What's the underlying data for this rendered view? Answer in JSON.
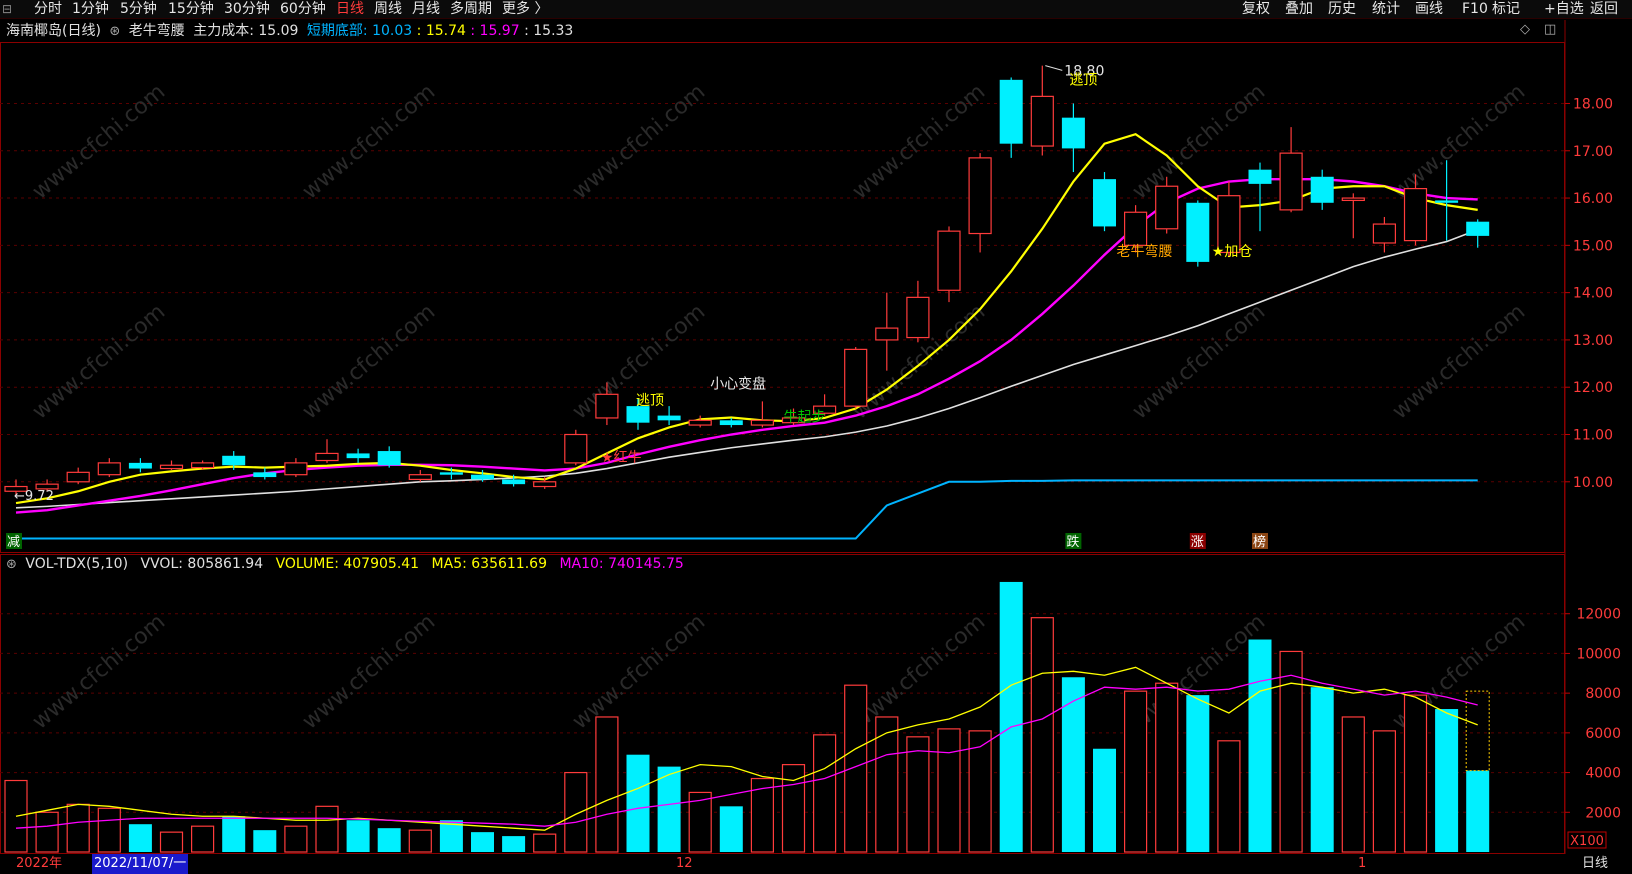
{
  "toolbar": {
    "periods": [
      "分时",
      "1分钟",
      "5分钟",
      "15分钟",
      "30分钟",
      "60分钟",
      "日线",
      "周线",
      "月线",
      "多周期",
      "更多 〉"
    ],
    "active_period": "日线",
    "right_buttons": [
      "复权",
      "叠加",
      "历史",
      "统计",
      "画线",
      "F10",
      "标记",
      "+自选",
      "返回"
    ]
  },
  "info": {
    "stock": "海南椰岛(日线)",
    "indicator": "老牛弯腰",
    "cost_label": "主力成本:",
    "cost_value": "15.09",
    "bottom_label": "短期底部:",
    "bottom_value": "10.03",
    "v1": "15.74",
    "v2": "15.97",
    "v3": "15.33"
  },
  "vol": {
    "name": "VOL-TDX(5,10)",
    "vvol": "VVOL: 805861.94",
    "volume": "VOLUME: 407905.41",
    "ma5": "MA5: 635611.69",
    "ma10": "MA10: 740145.75"
  },
  "price_axis": [
    "18.00",
    "17.00",
    "16.00",
    "15.00",
    "14.00",
    "13.00",
    "12.00",
    "11.00",
    "10.00"
  ],
  "vol_axis": [
    "12000",
    "10000",
    "8000",
    "6000",
    "4000",
    "2000"
  ],
  "vol_unit": "X100",
  "annotations": {
    "high": "18.80",
    "low": "9.72",
    "escape1": "逃顶",
    "escape2": "逃顶",
    "careful": "小心变盘",
    "bull_start": "牛起步",
    "red_bull": "★红牛",
    "old_bull": "老牛弯腰",
    "add_pos": "★加仓",
    "m_jian": "减",
    "m_die": "跌",
    "m_zhang": "涨",
    "m_bang": "榜"
  },
  "dates": {
    "year": "2022年",
    "sel": "2022/11/07/一",
    "m12": "12",
    "m1": "1"
  },
  "footer_period": "日线",
  "watermark": "www.cfchi.com",
  "colors": {
    "up": "#ff3b3b",
    "down": "#00f0ff",
    "ma_yellow": "#ffff00",
    "ma_magenta": "#ff00ff",
    "ma_white": "#e0e0e0",
    "bottom_line": "#00b4ff"
  },
  "chart_data": {
    "type": "candlestick",
    "candles": [
      {
        "o": 9.8,
        "c": 9.9,
        "h": 10.05,
        "l": 9.72,
        "v": 3600
      },
      {
        "o": 9.85,
        "c": 9.95,
        "h": 10.05,
        "l": 9.8,
        "v": 2000
      },
      {
        "o": 10.0,
        "c": 10.2,
        "h": 10.3,
        "l": 9.95,
        "v": 2400
      },
      {
        "o": 10.15,
        "c": 10.4,
        "h": 10.5,
        "l": 10.1,
        "v": 2200
      },
      {
        "o": 10.4,
        "c": 10.28,
        "h": 10.5,
        "l": 10.2,
        "v": 1400
      },
      {
        "o": 10.28,
        "c": 10.35,
        "h": 10.45,
        "l": 10.25,
        "v": 1000
      },
      {
        "o": 10.3,
        "c": 10.4,
        "h": 10.45,
        "l": 10.25,
        "v": 1300
      },
      {
        "o": 10.55,
        "c": 10.35,
        "h": 10.65,
        "l": 10.25,
        "v": 1800
      },
      {
        "o": 10.2,
        "c": 10.1,
        "h": 10.3,
        "l": 10.05,
        "v": 1100
      },
      {
        "o": 10.15,
        "c": 10.4,
        "h": 10.5,
        "l": 10.1,
        "v": 1300
      },
      {
        "o": 10.45,
        "c": 10.6,
        "h": 10.9,
        "l": 10.4,
        "v": 2300
      },
      {
        "o": 10.6,
        "c": 10.5,
        "h": 10.7,
        "l": 10.4,
        "v": 1600
      },
      {
        "o": 10.65,
        "c": 10.35,
        "h": 10.75,
        "l": 10.3,
        "v": 1200
      },
      {
        "o": 10.05,
        "c": 10.15,
        "h": 10.25,
        "l": 10.0,
        "v": 1100
      },
      {
        "o": 10.2,
        "c": 10.15,
        "h": 10.3,
        "l": 10.05,
        "v": 1600
      },
      {
        "o": 10.15,
        "c": 10.05,
        "h": 10.25,
        "l": 10.0,
        "v": 1000
      },
      {
        "o": 10.05,
        "c": 9.95,
        "h": 10.15,
        "l": 9.9,
        "v": 800
      },
      {
        "o": 9.9,
        "c": 10.0,
        "h": 10.1,
        "l": 9.85,
        "v": 900
      },
      {
        "o": 10.4,
        "c": 11.0,
        "h": 11.1,
        "l": 10.35,
        "v": 4000
      },
      {
        "o": 11.35,
        "c": 11.85,
        "h": 12.1,
        "l": 11.2,
        "v": 6800
      },
      {
        "o": 11.6,
        "c": 11.25,
        "h": 11.75,
        "l": 11.1,
        "v": 4900
      },
      {
        "o": 11.4,
        "c": 11.3,
        "h": 11.6,
        "l": 11.2,
        "v": 4300
      },
      {
        "o": 11.2,
        "c": 11.3,
        "h": 11.4,
        "l": 11.15,
        "v": 3000
      },
      {
        "o": 11.3,
        "c": 11.2,
        "h": 11.35,
        "l": 11.15,
        "v": 2300
      },
      {
        "o": 11.2,
        "c": 11.3,
        "h": 11.7,
        "l": 11.15,
        "v": 3700
      },
      {
        "o": 11.25,
        "c": 11.35,
        "h": 11.55,
        "l": 11.2,
        "v": 4400
      },
      {
        "o": 11.45,
        "c": 11.6,
        "h": 11.85,
        "l": 11.4,
        "v": 5900
      },
      {
        "o": 11.6,
        "c": 12.8,
        "h": 12.85,
        "l": 11.55,
        "v": 8400
      },
      {
        "o": 13.0,
        "c": 13.25,
        "h": 14.0,
        "l": 12.35,
        "v": 6800
      },
      {
        "o": 13.05,
        "c": 13.9,
        "h": 14.25,
        "l": 12.95,
        "v": 5800
      },
      {
        "o": 14.05,
        "c": 15.3,
        "h": 15.4,
        "l": 13.8,
        "v": 6200
      },
      {
        "o": 15.25,
        "c": 16.85,
        "h": 16.95,
        "l": 14.85,
        "v": 6100
      },
      {
        "o": 18.5,
        "c": 17.15,
        "h": 18.55,
        "l": 16.85,
        "v": 13600
      },
      {
        "o": 17.1,
        "c": 18.15,
        "h": 18.8,
        "l": 16.9,
        "v": 11800
      },
      {
        "o": 17.7,
        "c": 17.05,
        "h": 18.0,
        "l": 16.55,
        "v": 8800
      },
      {
        "o": 16.4,
        "c": 15.4,
        "h": 16.55,
        "l": 15.3,
        "v": 5200
      },
      {
        "o": 15.0,
        "c": 15.7,
        "h": 15.85,
        "l": 14.85,
        "v": 8100
      },
      {
        "o": 15.35,
        "c": 16.25,
        "h": 16.45,
        "l": 15.25,
        "v": 8500
      },
      {
        "o": 15.9,
        "c": 14.65,
        "h": 15.95,
        "l": 14.55,
        "v": 7900
      },
      {
        "o": 14.85,
        "c": 16.05,
        "h": 16.35,
        "l": 14.75,
        "v": 5600
      },
      {
        "o": 16.6,
        "c": 16.3,
        "h": 16.75,
        "l": 15.3,
        "v": 10700
      },
      {
        "o": 15.75,
        "c": 16.95,
        "h": 17.5,
        "l": 15.7,
        "v": 10100
      },
      {
        "o": 16.45,
        "c": 15.9,
        "h": 16.6,
        "l": 15.75,
        "v": 8300
      },
      {
        "o": 15.95,
        "c": 16.0,
        "h": 16.1,
        "l": 15.15,
        "v": 6800
      },
      {
        "o": 15.05,
        "c": 15.45,
        "h": 15.6,
        "l": 14.85,
        "v": 6100
      },
      {
        "o": 15.1,
        "c": 16.2,
        "h": 16.5,
        "l": 15.0,
        "v": 7900
      },
      {
        "o": 15.95,
        "c": 15.9,
        "h": 16.8,
        "l": 15.1,
        "v": 7200
      },
      {
        "o": 15.5,
        "c": 15.2,
        "h": 15.55,
        "l": 14.95,
        "v": 4100
      }
    ],
    "ma5_price": [
      9.55,
      9.65,
      9.8,
      10.0,
      10.15,
      10.22,
      10.28,
      10.32,
      10.3,
      10.32,
      10.34,
      10.38,
      10.4,
      10.34,
      10.25,
      10.18,
      10.1,
      10.05,
      10.28,
      10.6,
      10.92,
      11.15,
      11.32,
      11.36,
      11.3,
      11.28,
      11.35,
      11.55,
      11.95,
      12.45,
      13.0,
      13.65,
      14.45,
      15.35,
      16.35,
      17.15,
      17.35,
      16.9,
      16.25,
      15.8,
      15.85,
      15.95,
      16.2,
      16.25,
      16.25,
      16.0,
      15.85,
      15.75
    ],
    "ma10_price": [
      9.35,
      9.4,
      9.5,
      9.6,
      9.7,
      9.82,
      9.95,
      10.08,
      10.18,
      10.25,
      10.3,
      10.34,
      10.36,
      10.36,
      10.35,
      10.32,
      10.28,
      10.24,
      10.28,
      10.4,
      10.58,
      10.74,
      10.88,
      11.0,
      11.1,
      11.18,
      11.25,
      11.4,
      11.6,
      11.85,
      12.18,
      12.55,
      13.0,
      13.55,
      14.15,
      14.8,
      15.4,
      15.9,
      16.2,
      16.35,
      16.4,
      16.4,
      16.4,
      16.35,
      16.25,
      16.1,
      16.0,
      15.97
    ],
    "main_cost": [
      9.45,
      9.48,
      9.52,
      9.56,
      9.6,
      9.64,
      9.68,
      9.72,
      9.76,
      9.8,
      9.85,
      9.9,
      9.95,
      10.0,
      10.02,
      10.05,
      10.08,
      10.12,
      10.18,
      10.28,
      10.4,
      10.52,
      10.62,
      10.72,
      10.8,
      10.88,
      10.95,
      11.05,
      11.18,
      11.35,
      11.55,
      11.78,
      12.02,
      12.25,
      12.48,
      12.68,
      12.88,
      13.08,
      13.3,
      13.55,
      13.8,
      14.05,
      14.3,
      14.55,
      14.75,
      14.92,
      15.08,
      15.33
    ],
    "short_bottom": [
      8.8,
      8.8,
      8.8,
      8.8,
      8.8,
      8.8,
      8.8,
      8.8,
      8.8,
      8.8,
      8.8,
      8.8,
      8.8,
      8.8,
      8.8,
      8.8,
      8.8,
      8.8,
      8.8,
      8.8,
      8.8,
      8.8,
      8.8,
      8.8,
      8.8,
      8.8,
      8.8,
      8.8,
      9.5,
      9.75,
      10.0,
      10.0,
      10.02,
      10.02,
      10.03,
      10.03,
      10.03,
      10.03,
      10.03,
      10.03,
      10.03,
      10.03,
      10.03,
      10.03,
      10.03,
      10.03,
      10.03,
      10.03
    ],
    "vol_ma5": [
      1800,
      2100,
      2400,
      2300,
      2100,
      1900,
      1800,
      1800,
      1700,
      1600,
      1600,
      1700,
      1600,
      1500,
      1400,
      1300,
      1200,
      1100,
      1900,
      2600,
      3200,
      3900,
      4400,
      4300,
      3800,
      3600,
      4200,
      5200,
      6000,
      6400,
      6700,
      7300,
      8400,
      9000,
      9100,
      8900,
      9300,
      8500,
      7700,
      7000,
      8100,
      8500,
      8300,
      8000,
      8200,
      7800,
      7000,
      6400
    ],
    "vol_ma10": [
      1200,
      1300,
      1500,
      1600,
      1700,
      1700,
      1700,
      1700,
      1700,
      1700,
      1700,
      1650,
      1600,
      1550,
      1500,
      1450,
      1400,
      1300,
      1500,
      1900,
      2200,
      2400,
      2600,
      2900,
      3200,
      3400,
      3700,
      4300,
      4900,
      5100,
      5000,
      5300,
      6300,
      6700,
      7600,
      8300,
      8200,
      8300,
      8100,
      8200,
      8600,
      8900,
      8500,
      8200,
      7900,
      8100,
      7800,
      7400
    ],
    "price_range": [
      8.6,
      19.3
    ],
    "volume_range": [
      0,
      14000
    ]
  }
}
